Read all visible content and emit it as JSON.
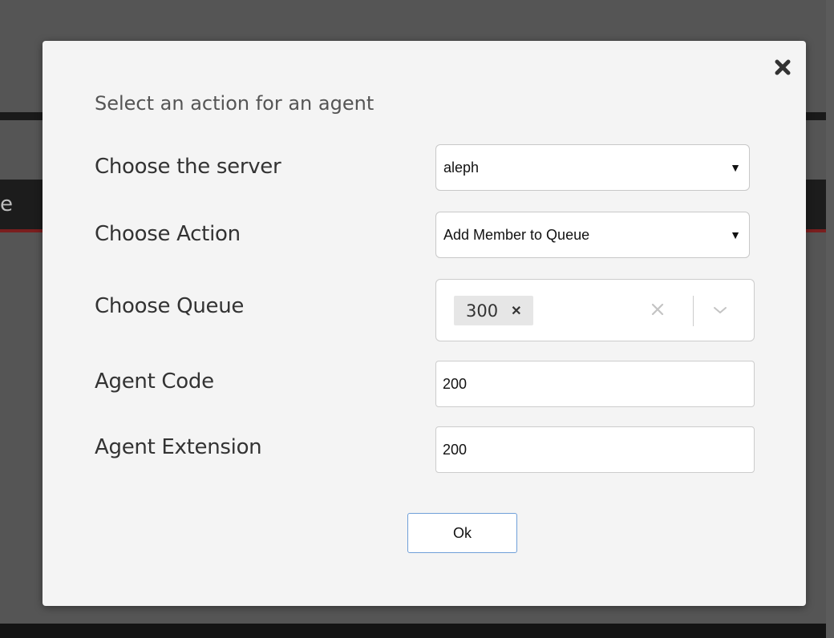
{
  "background": {
    "header_fragment": "e"
  },
  "modal": {
    "title": "Select an action for an agent",
    "close_icon": "close-x-icon",
    "fields": {
      "server": {
        "label": "Choose the server",
        "selected": "aleph"
      },
      "action": {
        "label": "Choose Action",
        "selected": "Add Member to Queue"
      },
      "queue": {
        "label": "Choose Queue",
        "chips": [
          "300"
        ]
      },
      "agent_code": {
        "label": "Agent Code",
        "value": "200"
      },
      "agent_extension": {
        "label": "Agent Extension",
        "value": "200"
      }
    },
    "ok_label": "Ok"
  },
  "colors": {
    "modal_bg": "#f4f4f4",
    "overlay": "#555555",
    "button_border": "#6f9fd8",
    "header_accent": "#7a1e1e"
  }
}
